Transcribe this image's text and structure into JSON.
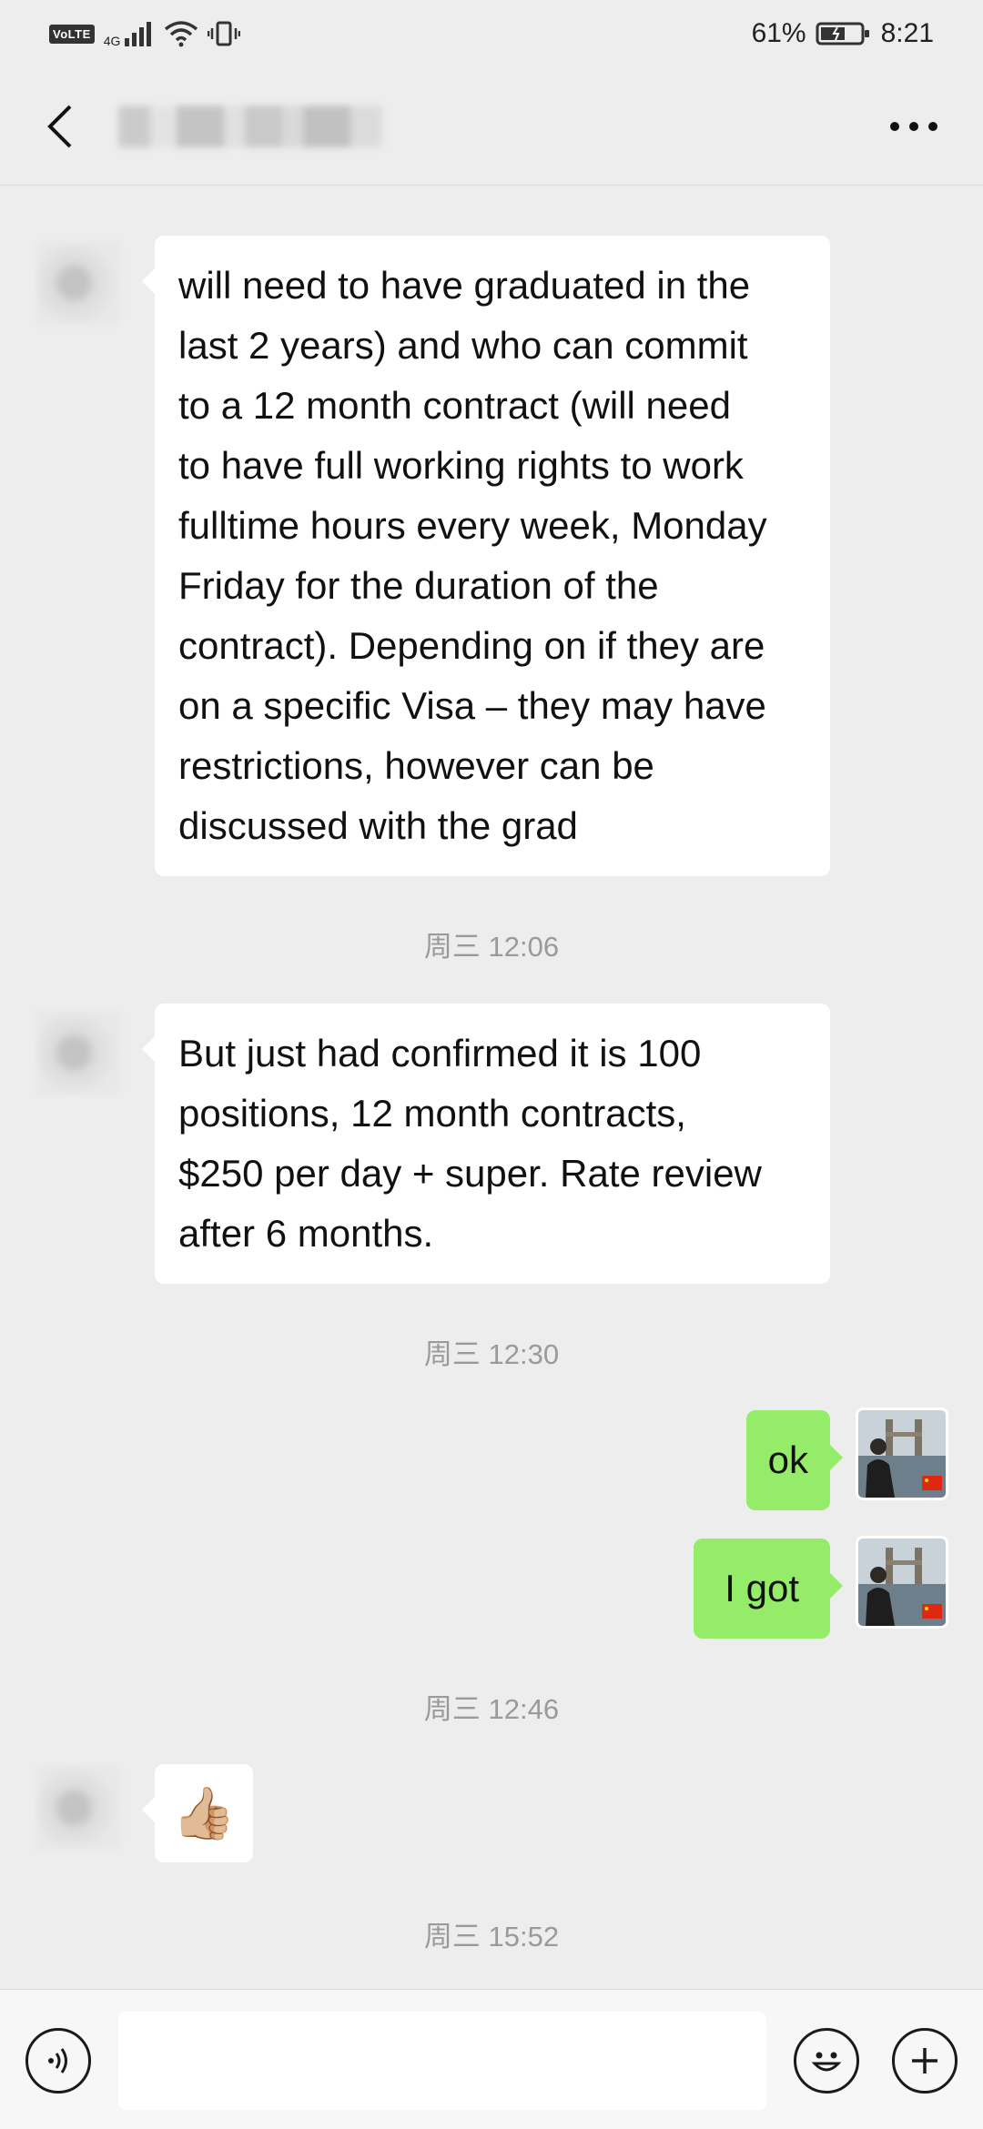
{
  "status_bar": {
    "volte": "VoLTE",
    "network": "4G",
    "battery_percent": "61%",
    "time": "8:21"
  },
  "header": {
    "contact_name_redacted": true,
    "back_icon": "chevron-left-icon",
    "more_icon": "more-dots-icon"
  },
  "messages": [
    {
      "sender": "contact",
      "lines": [
        "will need to have graduated in the",
        "last 2 years) and who can commit",
        "to a 12 month contract (will need",
        "to have full working rights to work",
        "fulltime hours every week, Monday",
        "Friday for the duration of the",
        "contract). Depending on if they are",
        "on a specific Visa – they may have",
        "restrictions, however can be",
        "discussed with the grad"
      ]
    },
    {
      "time": "周三 12:06"
    },
    {
      "sender": "contact",
      "lines": [
        "But just had confirmed it is 100",
        "positions, 12 month contracts,",
        "$250 per day + super. Rate review",
        "after 6 months."
      ]
    },
    {
      "time": "周三 12:30"
    },
    {
      "sender": "me",
      "text": "ok"
    },
    {
      "sender": "me",
      "text": "I got"
    },
    {
      "time": "周三 12:46"
    },
    {
      "sender": "contact",
      "emoji": "👍🏼"
    },
    {
      "time": "周三 15:52"
    }
  ],
  "input_bar": {
    "voice_icon": "voice-icon",
    "emoji_icon": "smile-icon",
    "plus_icon": "plus-icon",
    "input_value": ""
  },
  "colors": {
    "background": "#ededed",
    "my_bubble": "#95ec69",
    "their_bubble": "#ffffff",
    "timestamp": "#9a9a9a"
  }
}
